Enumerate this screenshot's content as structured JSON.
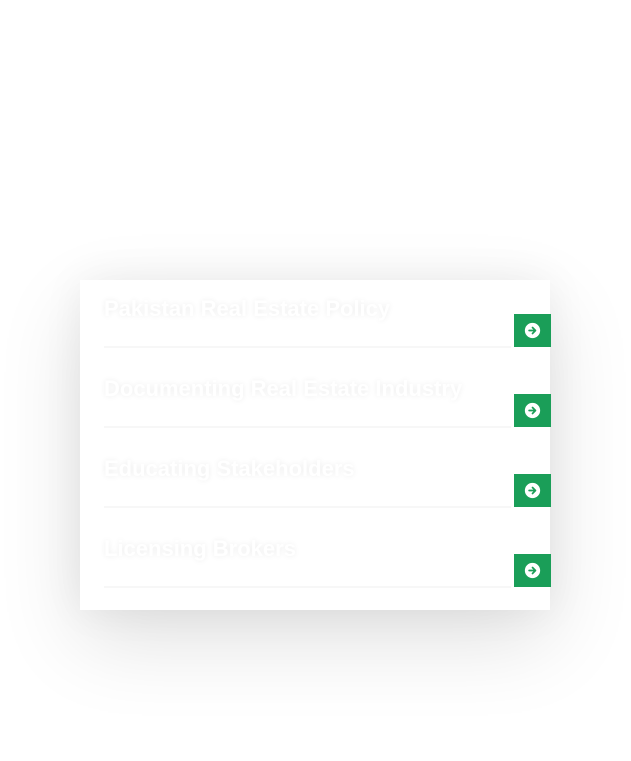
{
  "services": {
    "items": [
      {
        "title": "Pakistan Real Estate Policy",
        "icon": "arrow-right-circle-icon"
      },
      {
        "title": "Documenting Real Estate Industry",
        "icon": "arrow-right-circle-icon"
      },
      {
        "title": "Educating Stakeholders",
        "icon": "arrow-right-circle-icon"
      },
      {
        "title": "Licensing Brokers",
        "icon": "arrow-right-circle-icon"
      }
    ]
  },
  "colors": {
    "accent": "#1a9e58",
    "text": "#ffffff",
    "background": "#ffffff"
  }
}
